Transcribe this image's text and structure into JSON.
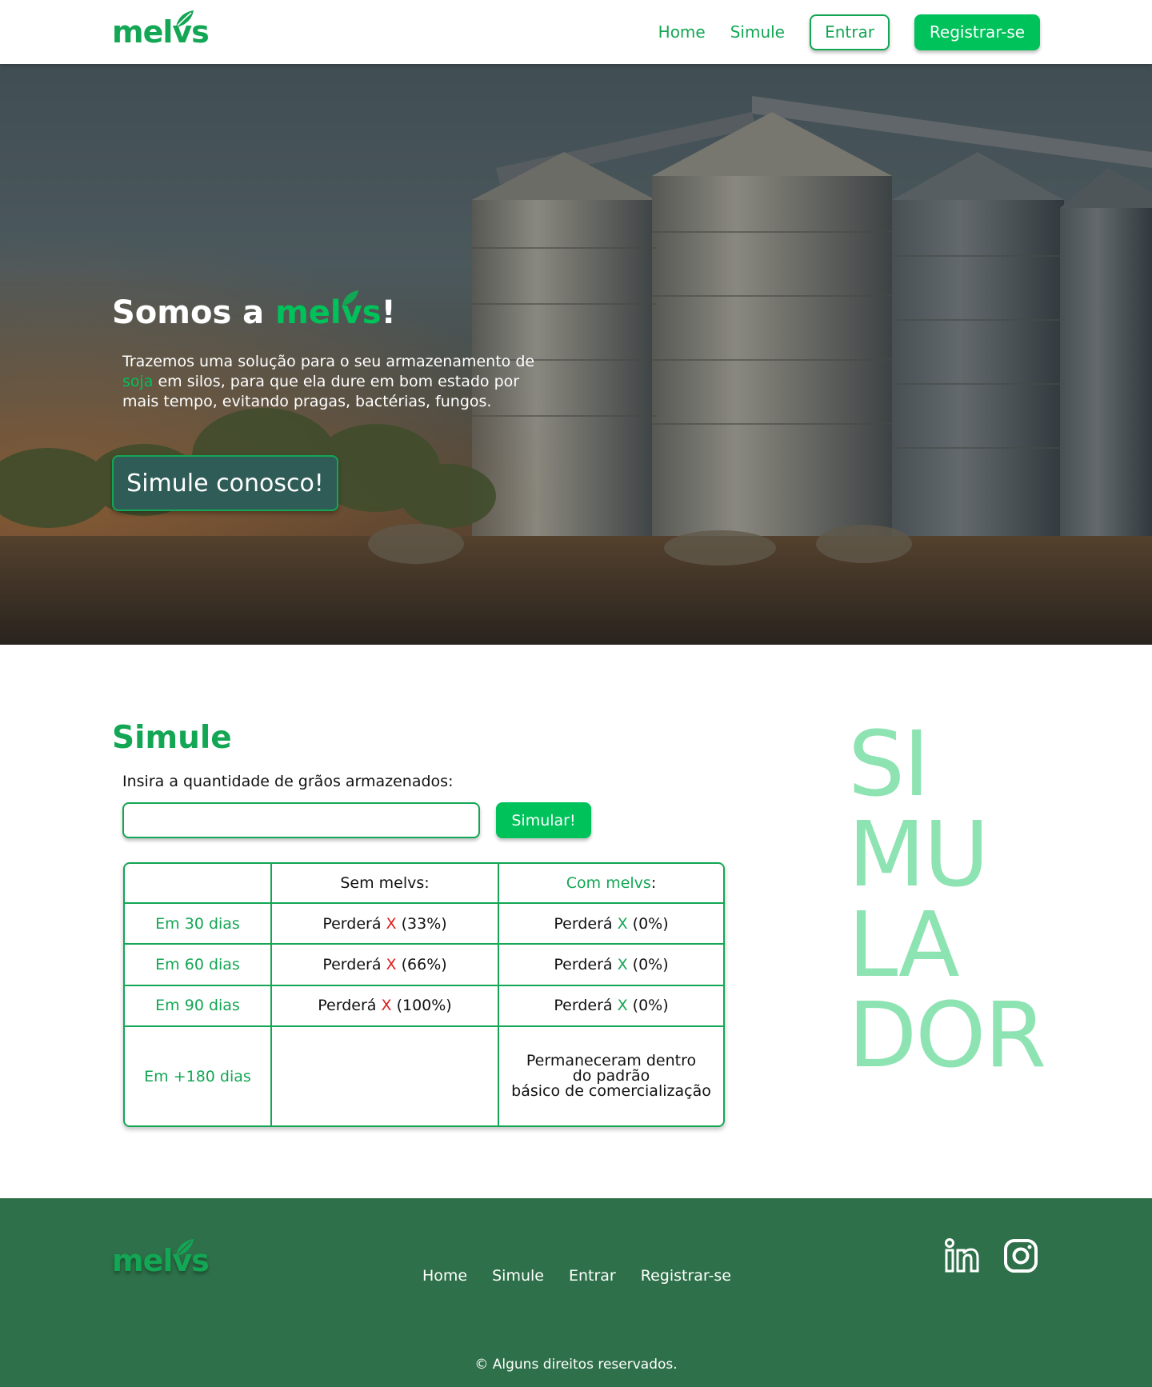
{
  "brand": {
    "name": "melvs"
  },
  "header": {
    "nav": {
      "home": "Home",
      "simule": "Simule",
      "entrar": "Entrar",
      "registrar": "Registrar-se"
    }
  },
  "hero": {
    "title_prefix": "Somos a ",
    "title_brand": "melvs",
    "title_suffix": "!",
    "text_1": "Trazemos uma solução para o seu armazenamento de ",
    "text_highlight": "soja",
    "text_2": " em silos, para que ela dure em bom estado por mais tempo, evitando pragas, bactérias, fungos.",
    "cta": "Simule conosco!"
  },
  "simulator": {
    "title": "Simule",
    "label": "Insira a quantidade de grãos armazenados:",
    "input_value": "",
    "button": "Simular!",
    "table": {
      "header_sem": "Sem melvs:",
      "header_com_brand": "Com melvs",
      "header_com_suffix": ":",
      "lose_word": "Perderá",
      "x_mark": "X",
      "rows": [
        {
          "period": "Em 30 dias",
          "sem_pct": "(33%)",
          "com_pct": "(0%)"
        },
        {
          "period": "Em 60 dias",
          "sem_pct": "(66%)",
          "com_pct": "(0%)"
        },
        {
          "period": "Em 90 dias",
          "sem_pct": "(100%)",
          "com_pct": "(0%)"
        }
      ],
      "last_row": {
        "period": "Em +180 dias",
        "note_1": "Permaneceram dentro",
        "note_2": "do padrão",
        "note_3": "básico de comercialização"
      }
    },
    "big_word": [
      "SI",
      "MU",
      "LA",
      "DOR"
    ]
  },
  "footer": {
    "nav": {
      "home": "Home",
      "simule": "Simule",
      "entrar": "Entrar",
      "registrar": "Registrar-se"
    },
    "copyright": "© Alguns direitos reservados."
  },
  "colors": {
    "brand_green": "#13a654",
    "button_green": "#00c25a",
    "light_green": "#8ee3b2",
    "footer_green": "#2e7049",
    "danger_red": "#e01b1b"
  }
}
